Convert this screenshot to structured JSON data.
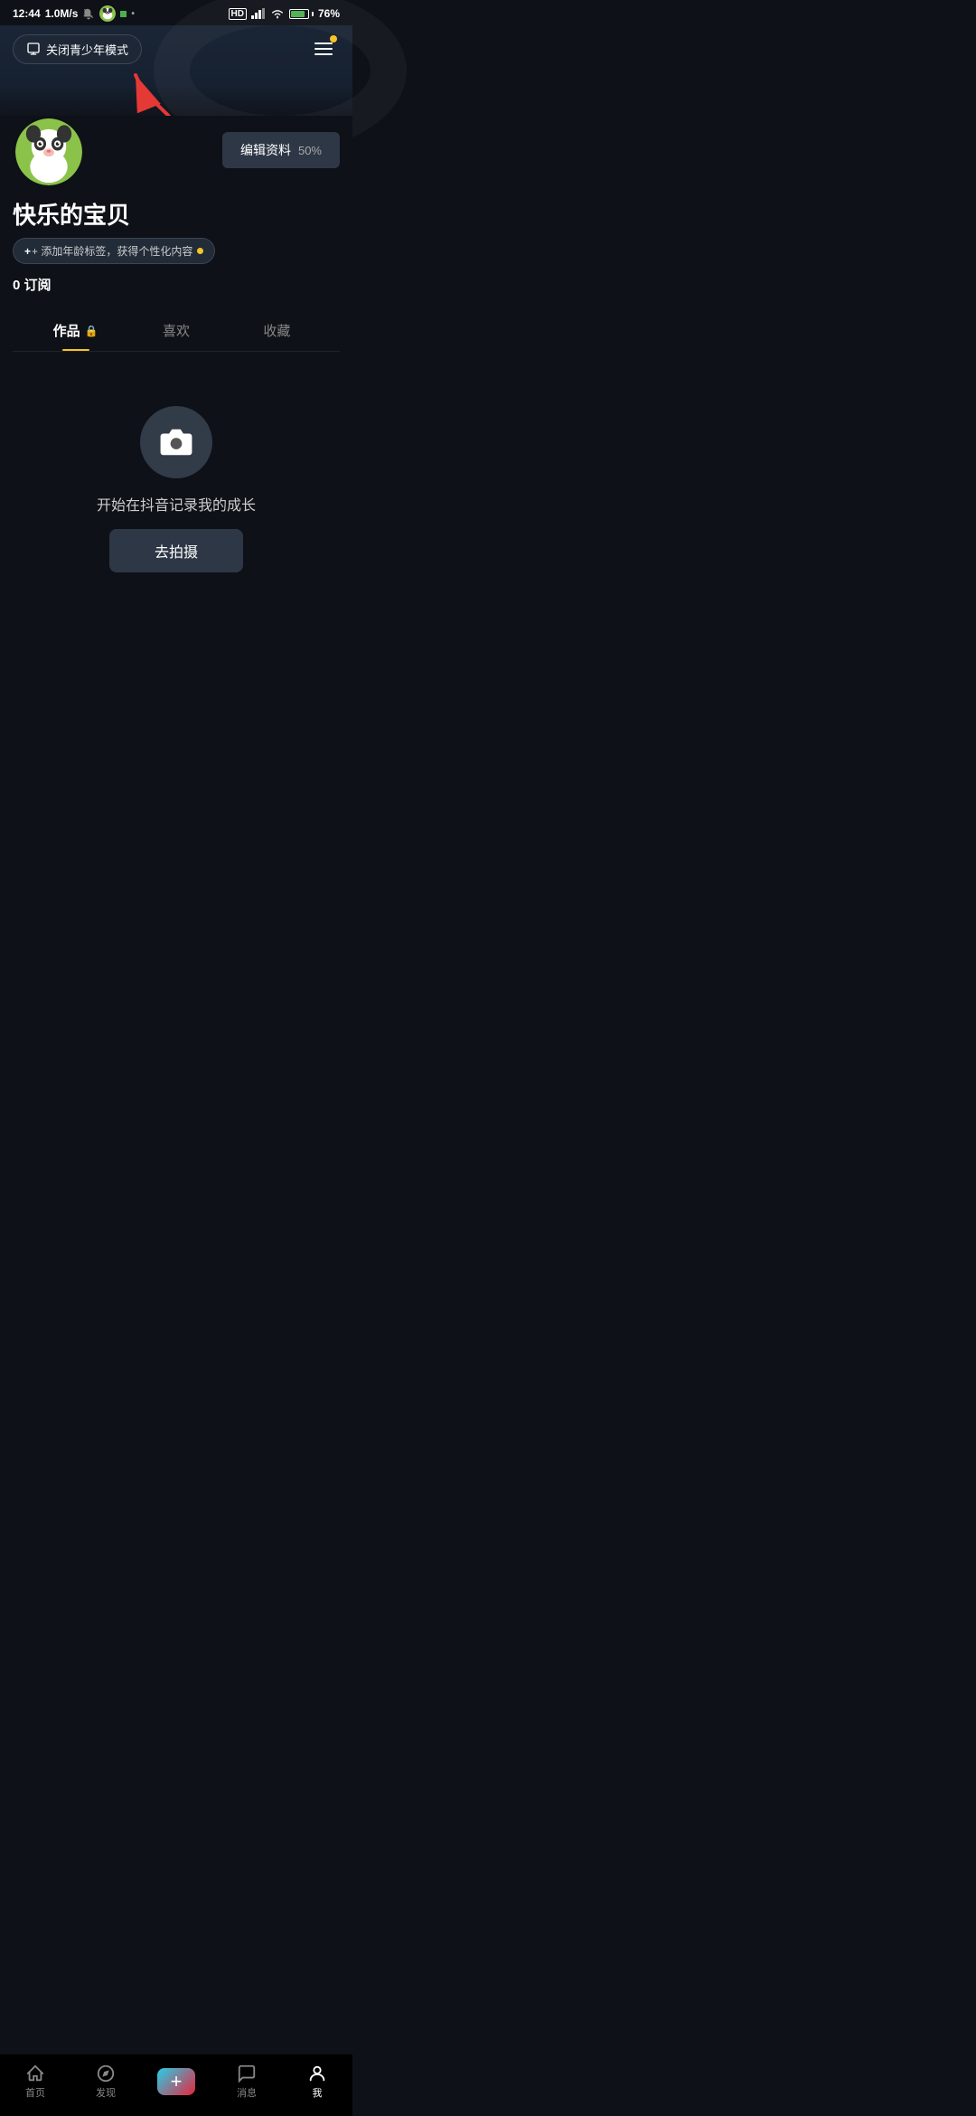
{
  "statusBar": {
    "time": "12:44",
    "network": "1.0M/s",
    "signal": "HD",
    "battery": "76%"
  },
  "header": {
    "youthModeBtn": "关闭青少年模式",
    "menuBtn": "menu"
  },
  "profile": {
    "username": "快乐的宝贝",
    "editBtn": "编辑资料",
    "editPercent": "50%",
    "ageTagBtn": "+ 添加年龄标签，获得个性化内容",
    "subscribeCount": "0",
    "subscribeLabel": "订阅"
  },
  "tabs": [
    {
      "id": "works",
      "label": "作品",
      "lock": true,
      "active": true
    },
    {
      "id": "likes",
      "label": "喜欢",
      "lock": false,
      "active": false
    },
    {
      "id": "favorites",
      "label": "收藏",
      "lock": false,
      "active": false
    }
  ],
  "emptyState": {
    "text": "开始在抖音记录我的成长",
    "shootBtn": "去拍摄"
  },
  "bottomNav": [
    {
      "id": "home",
      "label": "首页",
      "active": false
    },
    {
      "id": "discover",
      "label": "发现",
      "active": false
    },
    {
      "id": "add",
      "label": "+",
      "active": false
    },
    {
      "id": "messages",
      "label": "消息",
      "active": false
    },
    {
      "id": "profile",
      "label": "我",
      "active": true
    }
  ],
  "colors": {
    "accent": "#f7c325",
    "background": "#0e1117",
    "tabActive": "#ffffff"
  }
}
